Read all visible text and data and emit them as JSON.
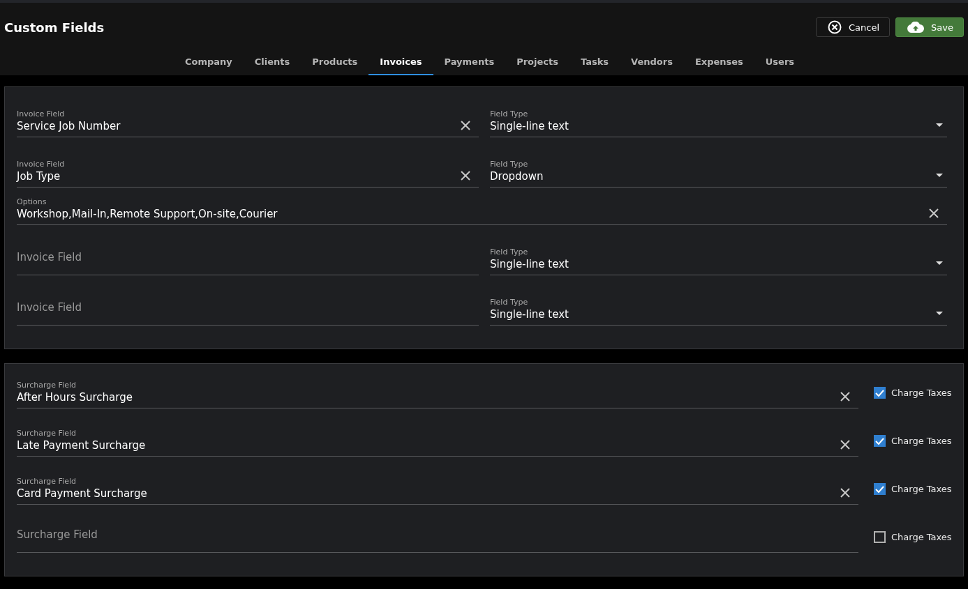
{
  "header": {
    "title": "Custom Fields",
    "buttons": [
      {
        "kind": "cancel",
        "label": "Cancel"
      },
      {
        "kind": "save",
        "label": "Save"
      }
    ]
  },
  "tabs": [
    {
      "label": "Company",
      "selected": false
    },
    {
      "label": "Clients",
      "selected": false
    },
    {
      "label": "Products",
      "selected": false
    },
    {
      "label": "Invoices",
      "selected": true
    },
    {
      "label": "Payments",
      "selected": false
    },
    {
      "label": "Projects",
      "selected": false
    },
    {
      "label": "Tasks",
      "selected": false
    },
    {
      "label": "Vendors",
      "selected": false
    },
    {
      "label": "Expenses",
      "selected": false
    },
    {
      "label": "Users",
      "selected": false
    }
  ],
  "invoice_fields": [
    {
      "kind": "field",
      "label": "Invoice Field",
      "value": "Service Job Number",
      "type_label": "Field Type",
      "type_value": "Single-line text"
    },
    {
      "kind": "field",
      "label": "Invoice Field",
      "value": "Job Type",
      "type_label": "Field Type",
      "type_value": "Dropdown"
    },
    {
      "kind": "options",
      "label": "Options",
      "value": "Workshop,Mail-In,Remote Support,On-site,Courier"
    },
    {
      "kind": "field",
      "placeholder": "Invoice Field",
      "type_label": "Field Type",
      "type_value": "Single-line text"
    },
    {
      "kind": "field",
      "placeholder": "Invoice Field",
      "type_label": "Field Type",
      "type_value": "Single-line text"
    }
  ],
  "surcharge_fields": [
    {
      "label": "Surcharge Field",
      "value": "After Hours Surcharge",
      "tax_label": "Charge Taxes",
      "checked": true
    },
    {
      "label": "Surcharge Field",
      "value": "Late Payment Surcharge",
      "tax_label": "Charge Taxes",
      "checked": true
    },
    {
      "label": "Surcharge Field",
      "value": "Card Payment Surcharge",
      "tax_label": "Charge Taxes",
      "checked": true
    },
    {
      "placeholder": "Surcharge Field",
      "tax_label": "Charge Taxes",
      "checked": false
    }
  ]
}
